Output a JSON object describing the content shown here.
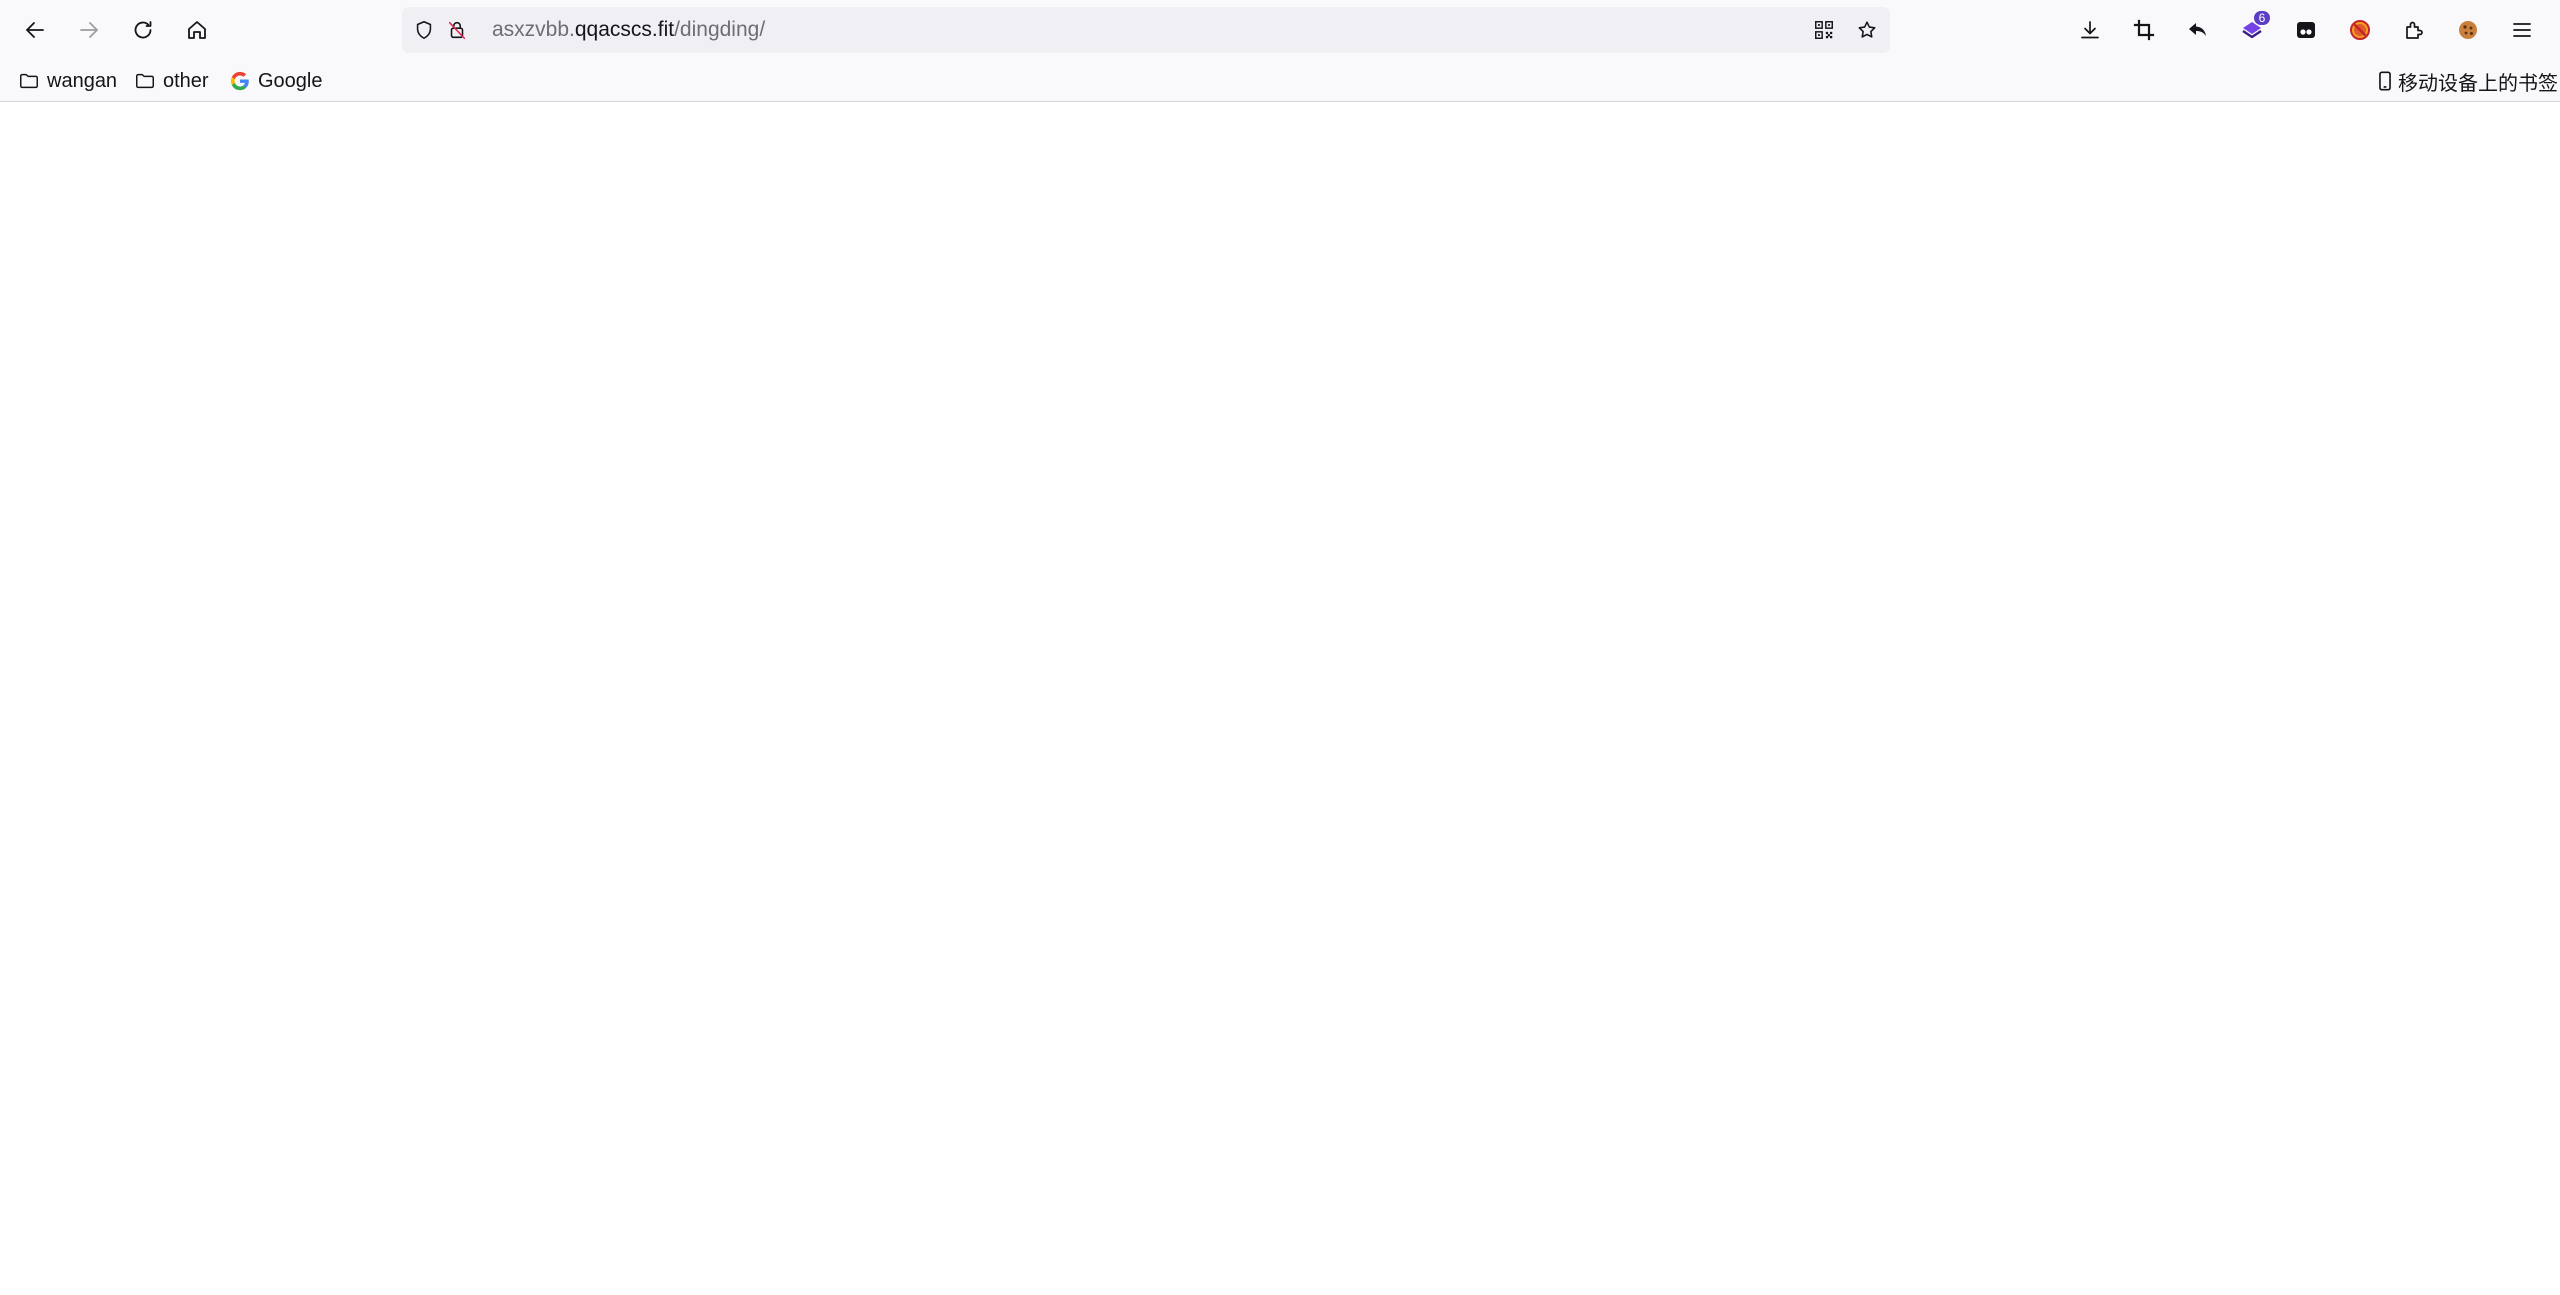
{
  "toolbar": {
    "back_icon": "arrow-left-icon",
    "forward_icon": "arrow-right-icon",
    "reload_icon": "reload-icon",
    "home_icon": "home-icon"
  },
  "urlbar": {
    "prefix": "asxzvbb.",
    "host": "qqacscs.fit",
    "path": "/dingding/"
  },
  "toolbar_right": {
    "extension_badge": "6"
  },
  "bookmarks": {
    "items": [
      {
        "label": "wangan",
        "icon": "folder-icon"
      },
      {
        "label": "other",
        "icon": "folder-icon"
      },
      {
        "label": "Google",
        "icon": "google-icon"
      }
    ],
    "mobile_label": "移动设备上的书签"
  },
  "colors": {
    "chrome_bg": "#f9f9fb",
    "urlbar_bg": "#f0f0f4",
    "badge_bg": "#5b3cc4",
    "text": "#15141a",
    "dim_text": "#6d6d74"
  }
}
